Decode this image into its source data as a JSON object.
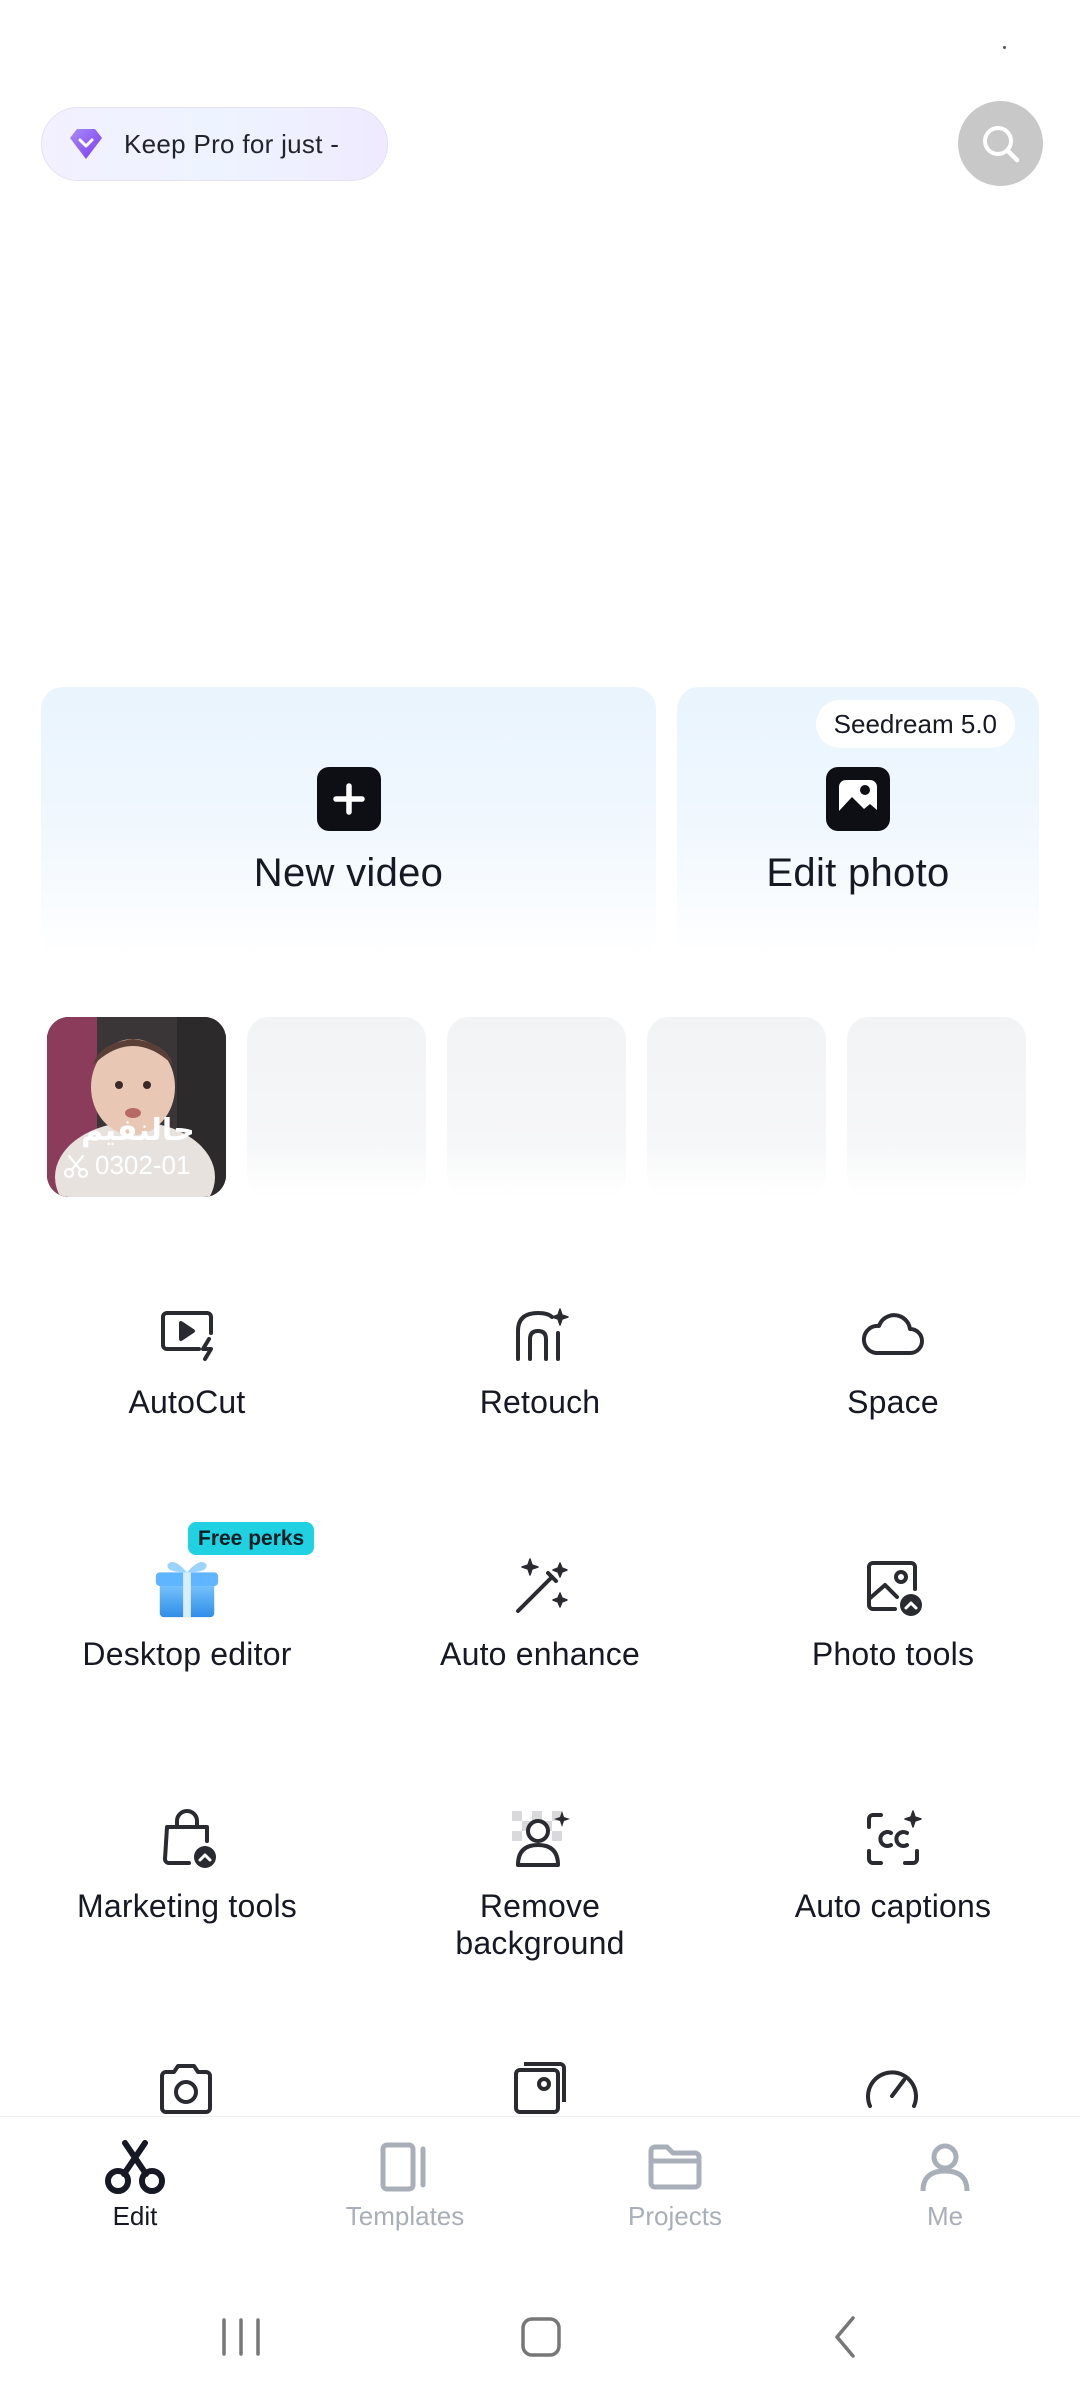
{
  "header": {
    "pro_label": "Keep Pro for just -",
    "pro_icon": "diamond-icon",
    "search_icon": "search-icon"
  },
  "cards": {
    "new_video": {
      "label": "New video",
      "icon": "plus-icon"
    },
    "edit_photo": {
      "label": "Edit photo",
      "icon": "image-icon",
      "badge": "Seedream 5.0"
    }
  },
  "drafts": {
    "first": {
      "caption": "0302-01",
      "overlay_text": "حالنفيم"
    }
  },
  "tools": [
    {
      "label": "AutoCut",
      "icon": "autocut-icon"
    },
    {
      "label": "Retouch",
      "icon": "retouch-icon"
    },
    {
      "label": "Space",
      "icon": "cloud-icon"
    },
    {
      "label": "Desktop editor",
      "icon": "gift-icon",
      "badge": "Free perks"
    },
    {
      "label": "Auto enhance",
      "icon": "magic-wand-icon"
    },
    {
      "label": "Photo tools",
      "icon": "photo-tools-icon"
    },
    {
      "label": "Marketing tools",
      "icon": "marketing-bag-icon"
    },
    {
      "label": "Remove background",
      "icon": "remove-bg-icon"
    },
    {
      "label": "Auto captions",
      "icon": "captions-icon"
    }
  ],
  "nav": {
    "items": [
      {
        "label": "Edit",
        "icon": "scissors-icon",
        "active": true
      },
      {
        "label": "Templates",
        "icon": "templates-icon",
        "active": false
      },
      {
        "label": "Projects",
        "icon": "folder-icon",
        "active": false
      },
      {
        "label": "Me",
        "icon": "person-icon",
        "active": false
      }
    ]
  },
  "colors": {
    "accent_badge": "#1fd1e1",
    "pro_gem": "#8b5cf6",
    "inactive_nav": "#a9afb8"
  }
}
